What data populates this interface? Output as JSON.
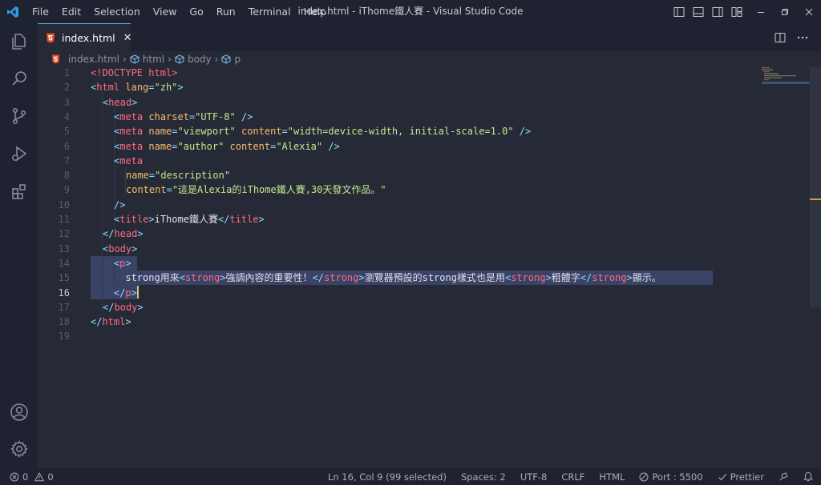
{
  "window": {
    "title": "index.html - iThome鐵人賽 - Visual Studio Code"
  },
  "menu": [
    "File",
    "Edit",
    "Selection",
    "View",
    "Go",
    "Run",
    "Terminal",
    "Help"
  ],
  "tab": {
    "label": "index.html",
    "close": "✕"
  },
  "breadcrumb": [
    "index.html",
    "html",
    "body",
    "p"
  ],
  "status": {
    "errors": "0",
    "warnings": "0",
    "position": "Ln 16, Col 9 (99 selected)",
    "spaces": "Spaces: 2",
    "encoding": "UTF-8",
    "eol": "CRLF",
    "language": "HTML",
    "port": "Port : 5500",
    "prettier": "Prettier"
  },
  "editor": {
    "line_numbers": [
      "1",
      "2",
      "3",
      "4",
      "5",
      "6",
      "7",
      "8",
      "9",
      "10",
      "11",
      "12",
      "13",
      "14",
      "15",
      "16",
      "17",
      "18",
      "19"
    ],
    "active_line": "16",
    "lines": {
      "l1": {
        "a": "<!DOCTYPE html>"
      },
      "l2": {
        "a": "<",
        "b": "html",
        "c": " lang",
        "d": "=",
        "e": "\"zh\"",
        "f": ">"
      },
      "l3": {
        "a": "<",
        "b": "head",
        "c": ">"
      },
      "l4": {
        "a": "<",
        "b": "meta",
        "c": " charset",
        "d": "=",
        "e": "\"UTF-8\"",
        "f": " />"
      },
      "l5": {
        "a": "<",
        "b": "meta",
        "c": " name",
        "d": "=",
        "e": "\"viewport\"",
        "f": " content",
        "g": "=",
        "h": "\"width=device-width, initial-scale=1.0\"",
        "i": " />"
      },
      "l6": {
        "a": "<",
        "b": "meta",
        "c": " name",
        "d": "=",
        "e": "\"author\"",
        "f": " content",
        "g": "=",
        "h": "\"Alexia\"",
        "i": " />"
      },
      "l7": {
        "a": "<",
        "b": "meta"
      },
      "l8": {
        "a": "name",
        "b": "=",
        "c": "\"description\""
      },
      "l9": {
        "a": "content",
        "b": "=",
        "c": "\"這是Alexia的iThome鐵人賽,30天發文作品。\""
      },
      "l10": {
        "a": "/>"
      },
      "l11": {
        "a": "<",
        "b": "title",
        "c": ">",
        "d": "iThome鐵人賽",
        "e": "</",
        "f": "title",
        "g": ">"
      },
      "l12": {
        "a": "</",
        "b": "head",
        "c": ">"
      },
      "l13": {
        "a": "<",
        "b": "body",
        "c": ">"
      },
      "l14": {
        "ws": "····",
        "a": "<",
        "b": "p",
        "c": ">"
      },
      "l15": {
        "ws": "······",
        "a": "strong用來",
        "b": "<",
        "c": "strong",
        "d": ">",
        "e": "強調內容的重要性！",
        "f": "</",
        "g": "strong",
        "h": ">",
        "i": "瀏覽器預設的strong樣式也是用",
        "j": "<",
        "k": "strong",
        "l": ">",
        "m": "粗體字",
        "n": "</",
        "o": "strong",
        "p": ">",
        "q": "顯示。"
      },
      "l16": {
        "ws": "····",
        "a": "</",
        "b": "p",
        "c": ">"
      },
      "l17": {
        "a": "</",
        "b": "body",
        "c": ">"
      },
      "l18": {
        "a": "</",
        "b": "html",
        "c": ">"
      }
    }
  },
  "colors": {
    "accent": "#5ea6d9",
    "tag": "#ff6b81",
    "attr": "#f7bd6b",
    "string": "#c3e88d",
    "html_icon": "#e44d26"
  }
}
